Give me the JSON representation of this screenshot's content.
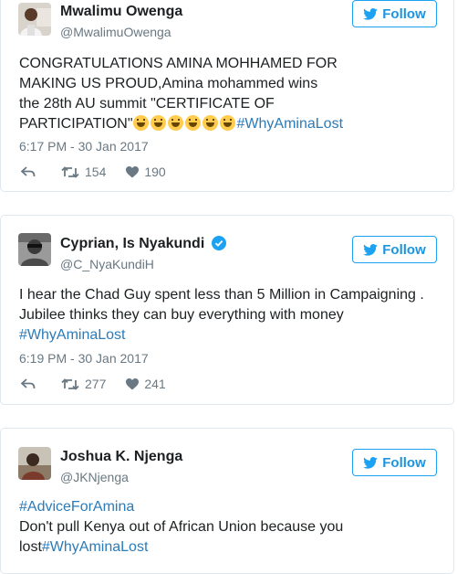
{
  "tweets": [
    {
      "name": "Mwalimu Owenga",
      "handle": "@MwalimuOwenga",
      "follow_label": "Follow",
      "text_lines": [
        "CONGRATULATIONS AMINA MOHHAMED FOR",
        "MAKING US PROUD,Amina mohammed wins",
        "the 28th AU summit \"CERTIFICATE OF",
        "PARTICIPATION\""
      ],
      "emoji_count": 6,
      "hashtag": "#WhyAminaLost",
      "time": "6:17 PM - 30 Jan 2017",
      "retweets": "154",
      "likes": "190"
    },
    {
      "name": "Cyprian, Is Nyakundi",
      "handle": "@C_NyaKundiH",
      "verified": true,
      "follow_label": "Follow",
      "text_lines": [
        "I hear the Chad Guy spent less than 5 Million in Campaigning .",
        "Jubilee thinks they can buy everything with money"
      ],
      "hashtag": "#WhyAminaLost",
      "time": "6:19 PM - 30 Jan 2017",
      "retweets": "277",
      "likes": "241"
    },
    {
      "name": "Joshua K. Njenga",
      "handle": "@JKNjenga",
      "follow_label": "Follow",
      "hashtag_top": "#AdviceForAmina",
      "text_line_1": "Don't pull Kenya out of African Union because you",
      "text_line_2_prefix": "lost",
      "hashtag": "#WhyAminaLost"
    }
  ],
  "colors": {
    "link": "#2b7bb9",
    "follow": "#1da1f2",
    "muted": "#697882",
    "border": "#e1e8ed"
  }
}
